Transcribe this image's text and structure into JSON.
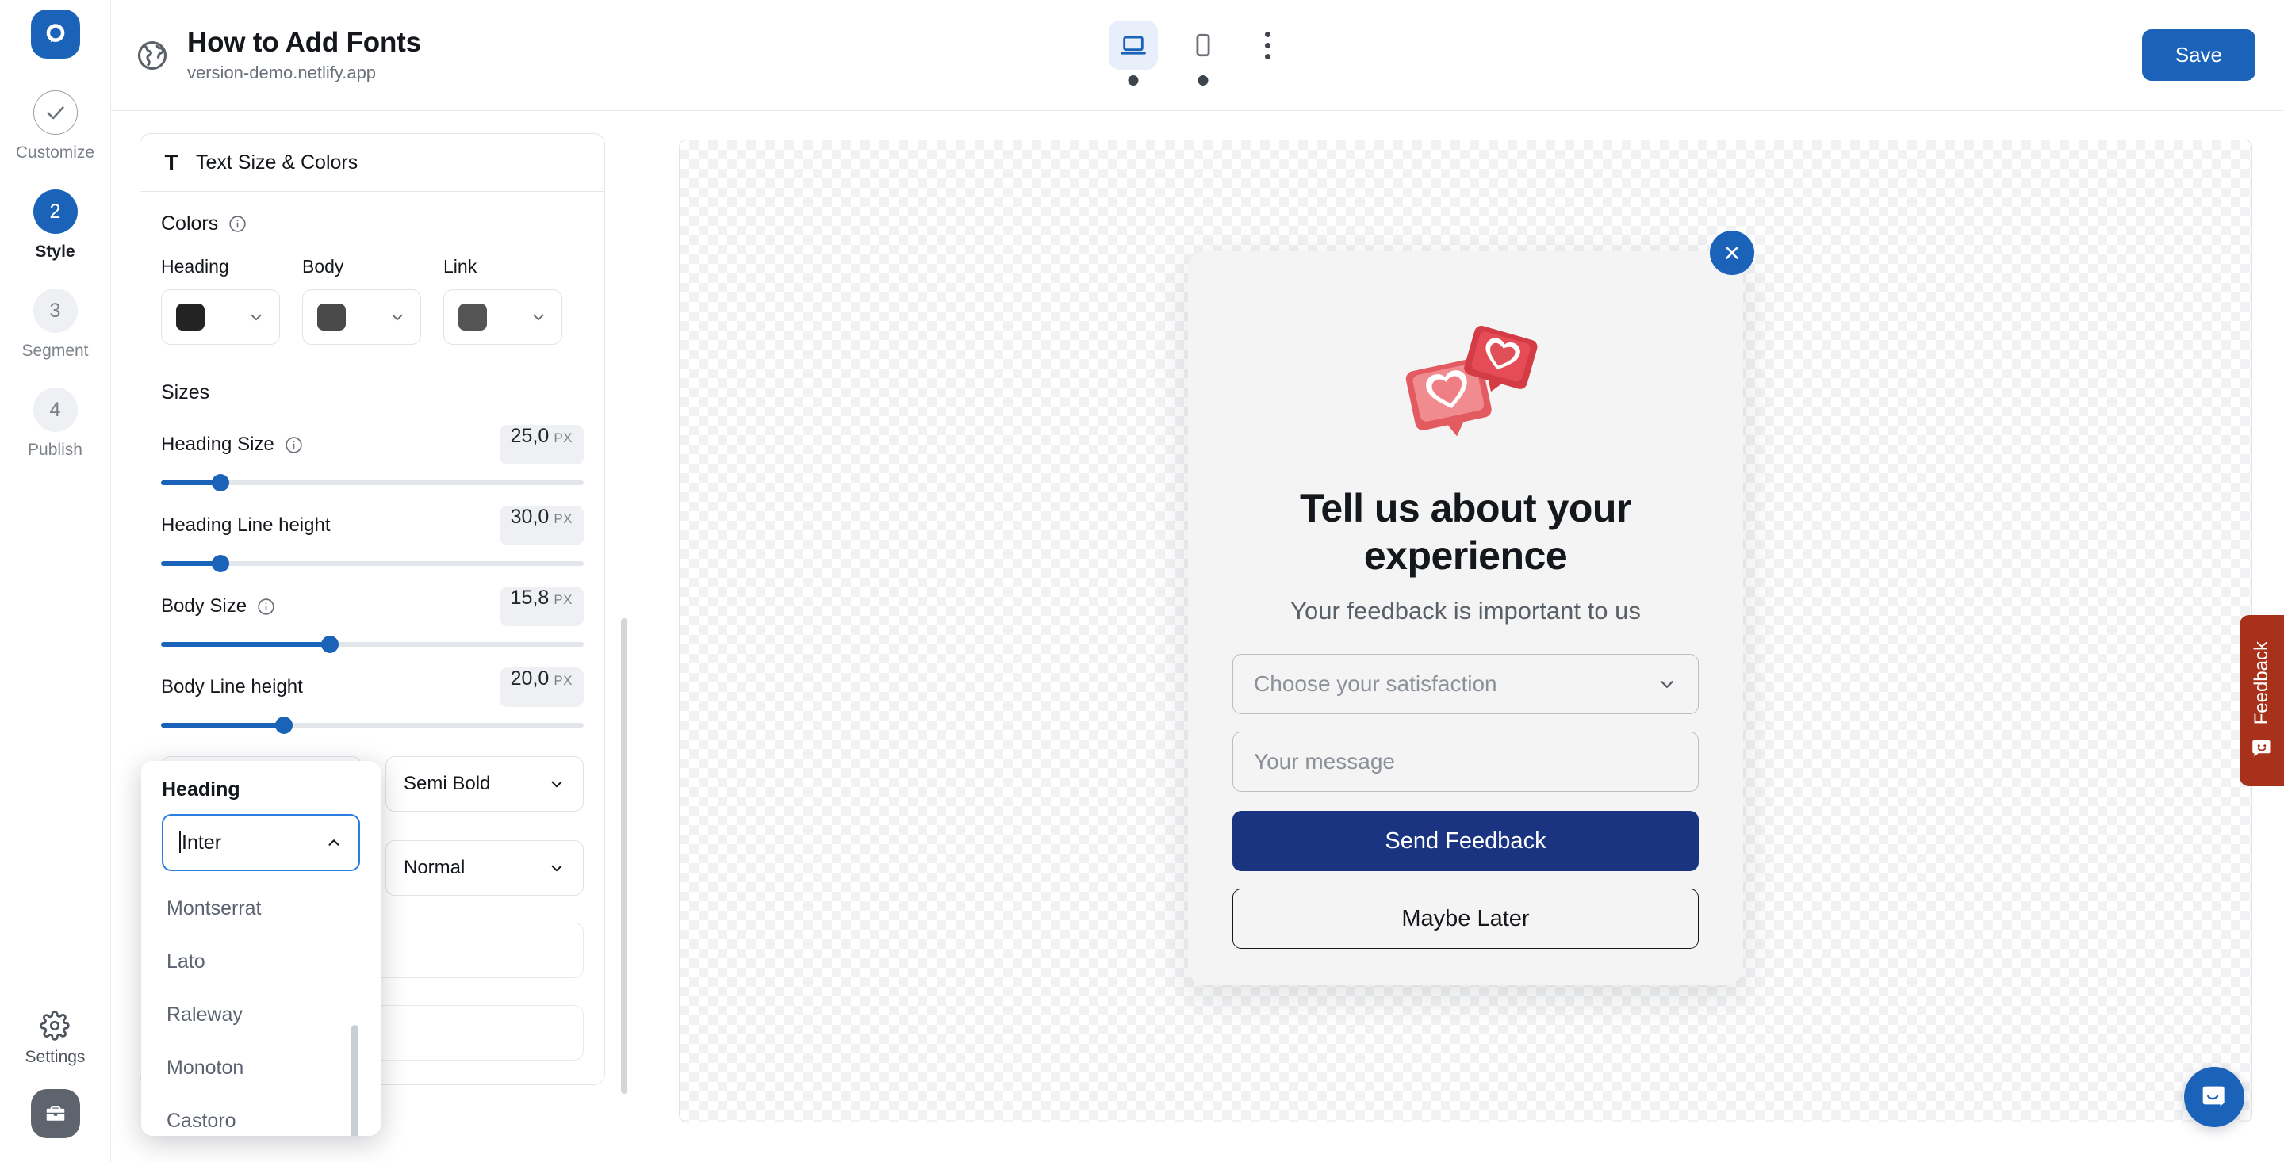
{
  "colors": {
    "brand_blue": "#1a63b8",
    "modal_primary": "#1b3481",
    "feedback_tab": "#a8311c",
    "heading_swatch": "#232323",
    "body_swatch": "#4a4a4a",
    "link_swatch": "#545454"
  },
  "rail": {
    "logo_icon": "prompt-logo-icon",
    "steps": [
      {
        "num": "",
        "label": "Customize",
        "state": "done",
        "icon": "check-icon"
      },
      {
        "num": "2",
        "label": "Style",
        "state": "active"
      },
      {
        "num": "3",
        "label": "Segment",
        "state": "pending"
      },
      {
        "num": "4",
        "label": "Publish",
        "state": "pending"
      }
    ],
    "settings_label": "Settings",
    "settings_icon": "gear-icon",
    "briefcase_icon": "briefcase-icon"
  },
  "topbar": {
    "globe_icon": "globe-icon",
    "title": "How to Add Fonts",
    "subtitle": "version-demo.netlify.app",
    "devices": [
      {
        "name": "desktop",
        "icon": "desktop-icon",
        "active": true
      },
      {
        "name": "mobile",
        "icon": "mobile-icon",
        "active": false
      }
    ],
    "more_icon": "kebab-menu-icon",
    "save_label": "Save"
  },
  "panel": {
    "card_title": "Text Size & Colors",
    "card_icon": "text-T-icon",
    "colors_title": "Colors",
    "color_fields": [
      {
        "label": "Heading",
        "swatch": "#232323"
      },
      {
        "label": "Body",
        "swatch": "#4a4a4a"
      },
      {
        "label": "Link",
        "swatch": "#545454"
      }
    ],
    "sizes_title": "Sizes",
    "sliders": [
      {
        "label": "Heading Size",
        "has_info": true,
        "value": "25,0",
        "unit": "PX",
        "pct": 14
      },
      {
        "label": "Heading Line height",
        "has_info": false,
        "value": "30,0",
        "unit": "PX",
        "pct": 14
      },
      {
        "label": "Body Size",
        "has_info": true,
        "value": "15,8",
        "unit": "PX",
        "pct": 40
      },
      {
        "label": "Body Line height",
        "has_info": false,
        "value": "20,0",
        "unit": "PX",
        "pct": 29
      }
    ],
    "weight_heading": {
      "value": "Semi Bold"
    },
    "weight_body": {
      "value": "Normal"
    }
  },
  "font_popover": {
    "label": "Heading",
    "input_value": "Inter",
    "options": [
      "Montserrat",
      "Lato",
      "Raleway",
      "Monoton",
      "Castoro"
    ],
    "chevron_icon": "chevron-up-icon"
  },
  "preview": {
    "modal": {
      "close_icon": "close-x-icon",
      "emoji_icon": "heart-reaction-icon",
      "heading": "Tell us about your experience",
      "subheading": "Your feedback is important to us",
      "select_placeholder": "Choose your satisfaction",
      "message_placeholder": "Your message",
      "primary_label": "Send Feedback",
      "secondary_label": "Maybe Later"
    }
  },
  "feedback_tab": {
    "label": "Feedback",
    "icon": "smiley-chat-icon"
  },
  "chat_widget": {
    "icon": "chat-bubble-icon"
  }
}
